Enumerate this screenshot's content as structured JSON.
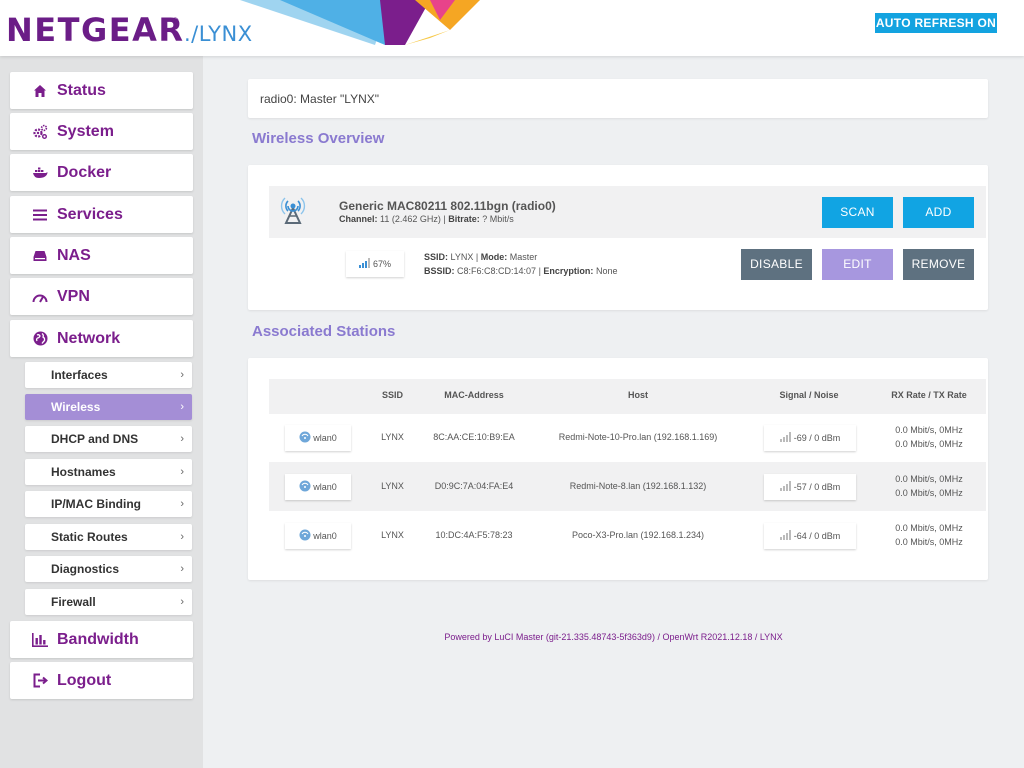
{
  "header": {
    "brand": "NETGEAR",
    "brand_mark": "®",
    "product": "./LYNX",
    "auto_refresh_label": "AUTO REFRESH ON"
  },
  "sidebar": {
    "items": [
      {
        "label": "Status",
        "icon": "home-icon"
      },
      {
        "label": "System",
        "icon": "gears-icon"
      },
      {
        "label": "Docker",
        "icon": "docker-icon"
      },
      {
        "label": "Services",
        "icon": "list-icon"
      },
      {
        "label": "NAS",
        "icon": "drive-icon"
      },
      {
        "label": "VPN",
        "icon": "gauge-icon"
      },
      {
        "label": "Network",
        "icon": "globe-icon"
      }
    ],
    "network_subitems": [
      {
        "label": "Interfaces",
        "active": false
      },
      {
        "label": "Wireless",
        "active": true
      },
      {
        "label": "DHCP and DNS",
        "active": false
      },
      {
        "label": "Hostnames",
        "active": false
      },
      {
        "label": "IP/MAC Binding",
        "active": false
      },
      {
        "label": "Static Routes",
        "active": false
      },
      {
        "label": "Diagnostics",
        "active": false
      },
      {
        "label": "Firewall",
        "active": false
      }
    ],
    "bottom_items": [
      {
        "label": "Bandwidth",
        "icon": "bar-chart-icon"
      },
      {
        "label": "Logout",
        "icon": "logout-icon"
      }
    ],
    "sub_arrow": "›"
  },
  "main": {
    "page_heading": "radio0: Master \"LYNX\"",
    "wireless_overview_title": "Wireless Overview",
    "radio": {
      "name": "Generic MAC80211 802.11bgn (radio0)",
      "channel_label": "Channel:",
      "channel_value": "11 (2.462 GHz)",
      "bitrate_label": "Bitrate:",
      "bitrate_value": "? Mbit/s",
      "scan_label": "SCAN",
      "add_label": "ADD"
    },
    "network": {
      "signal_percent": "67%",
      "ssid_label": "SSID:",
      "ssid_value": "LYNX",
      "mode_label": "Mode:",
      "mode_value": "Master",
      "bssid_label": "BSSID:",
      "bssid_value": "C8:F6:C8:CD:14:07",
      "encryption_label": "Encryption:",
      "encryption_value": "None",
      "disable_label": "DISABLE",
      "edit_label": "EDIT",
      "remove_label": "REMOVE"
    },
    "stations_title": "Associated Stations",
    "stations_columns": [
      "",
      "SSID",
      "MAC-Address",
      "Host",
      "Signal / Noise",
      "RX Rate / TX Rate"
    ],
    "stations": [
      {
        "iface": "wlan0",
        "ssid": "LYNX",
        "mac": "8C:AA:CE:10:B9:EA",
        "host": "Redmi-Note-10-Pro.lan (192.168.1.169)",
        "signal": "-69 / 0 dBm",
        "rx": "0.0 Mbit/s, 0MHz",
        "tx": "0.0 Mbit/s, 0MHz"
      },
      {
        "iface": "wlan0",
        "ssid": "LYNX",
        "mac": "D0:9C:7A:04:FA:E4",
        "host": "Redmi-Note-8.lan (192.168.1.132)",
        "signal": "-57 / 0 dBm",
        "rx": "0.0 Mbit/s, 0MHz",
        "tx": "0.0 Mbit/s, 0MHz"
      },
      {
        "iface": "wlan0",
        "ssid": "LYNX",
        "mac": "10:DC:4A:F5:78:23",
        "host": "Poco-X3-Pro.lan (192.168.1.234)",
        "signal": "-64 / 0 dBm",
        "rx": "0.0 Mbit/s, 0MHz",
        "tx": "0.0 Mbit/s, 0MHz"
      }
    ]
  },
  "footer": {
    "text": "Powered by LuCI Master (git-21.335.48743-5f363d9) / OpenWrt R2021.12.18 / LYNX"
  },
  "colors": {
    "brand_purple": "#6b1d87",
    "menu_purple": "#7b1e8c",
    "accent_blue": "#11a4e3",
    "slate": "#5e7180",
    "lavender": "#a797df",
    "section_title": "#8a7ad0"
  }
}
